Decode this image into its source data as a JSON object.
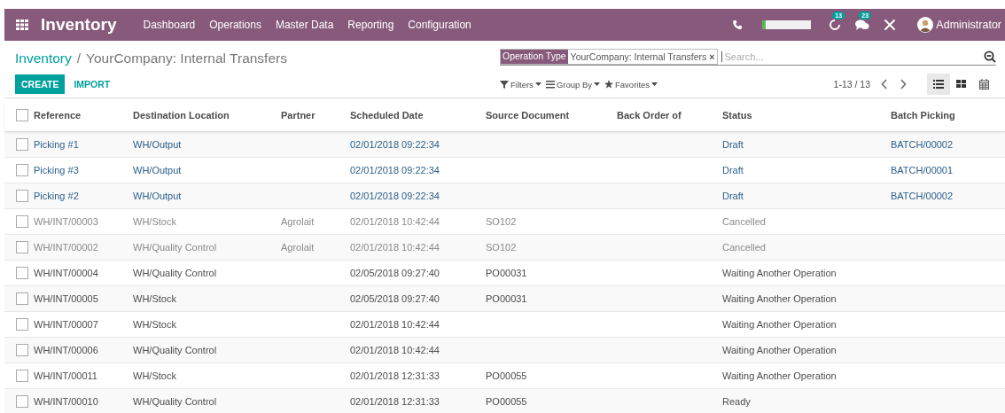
{
  "navbar": {
    "app_title": "Inventory",
    "menu": [
      "Dashboard",
      "Operations",
      "Master Data",
      "Reporting",
      "Configuration"
    ],
    "progress": {
      "level": 0.06
    },
    "activity_badge": "13",
    "messages_badge": "23",
    "user": "Administrator"
  },
  "breadcrumb": {
    "parent": "Inventory",
    "separator": "/",
    "current": "YourCompany: Internal Transfers"
  },
  "buttons": [
    "CREATE",
    "IMPORT"
  ],
  "search": {
    "facet": {
      "label": "Operation Type",
      "value": "YourCompany: Internal Transfers",
      "remove": "×"
    },
    "placeholder": "Search..."
  },
  "filters": [
    "Filters",
    "Group By",
    "Favorites"
  ],
  "pager": "1-13 / 13",
  "views": [
    {
      "kind": "list",
      "selected": true
    },
    {
      "kind": "kanban",
      "selected": false
    },
    {
      "kind": "calendar",
      "selected": false
    }
  ],
  "table": {
    "select_all": {
      "checked": false
    },
    "columns": [
      "Reference",
      "Destination Location",
      "Partner",
      "Scheduled Date",
      "Source Document",
      "Back Order of",
      "Status",
      "Batch Picking"
    ],
    "rows": [
      {
        "checked": false,
        "kind": "draft",
        "cells": [
          "Picking #1",
          "WH/Output",
          "",
          "02/01/2018 09:22:34",
          "",
          "",
          "Draft",
          "BATCH/00002"
        ]
      },
      {
        "checked": false,
        "kind": "draft",
        "cells": [
          "Picking #3",
          "WH/Output",
          "",
          "02/01/2018 09:22:34",
          "",
          "",
          "Draft",
          "BATCH/00001"
        ]
      },
      {
        "checked": false,
        "kind": "draft",
        "cells": [
          "Picking #2",
          "WH/Output",
          "",
          "02/01/2018 09:22:34",
          "",
          "",
          "Draft",
          "BATCH/00002"
        ]
      },
      {
        "checked": false,
        "kind": "cancelled",
        "cells": [
          "WH/INT/00003",
          "WH/Stock",
          "Agrolait",
          "02/01/2018 10:42:44",
          "SO102",
          "",
          "Cancelled",
          ""
        ]
      },
      {
        "checked": false,
        "kind": "cancelled",
        "cells": [
          "WH/INT/00002",
          "WH/Quality Control",
          "Agrolait",
          "02/01/2018 10:42:44",
          "SO102",
          "",
          "Cancelled",
          ""
        ]
      },
      {
        "checked": false,
        "kind": "normal",
        "cells": [
          "WH/INT/00004",
          "WH/Quality Control",
          "",
          "02/05/2018 09:27:40",
          "PO00031",
          "",
          "Waiting Another Operation",
          ""
        ]
      },
      {
        "checked": false,
        "kind": "normal",
        "cells": [
          "WH/INT/00005",
          "WH/Stock",
          "",
          "02/05/2018 09:27:40",
          "PO00031",
          "",
          "Waiting Another Operation",
          ""
        ]
      },
      {
        "checked": false,
        "kind": "normal",
        "cells": [
          "WH/INT/00007",
          "WH/Stock",
          "",
          "02/01/2018 10:42:44",
          "",
          "",
          "Waiting Another Operation",
          ""
        ]
      },
      {
        "checked": false,
        "kind": "normal",
        "cells": [
          "WH/INT/00006",
          "WH/Quality Control",
          "",
          "02/01/2018 10:42:44",
          "",
          "",
          "Waiting Another Operation",
          ""
        ]
      },
      {
        "checked": false,
        "kind": "normal",
        "cells": [
          "WH/INT/00011",
          "WH/Stock",
          "",
          "02/01/2018 12:31:33",
          "PO00055",
          "",
          "Waiting Another Operation",
          ""
        ]
      },
      {
        "checked": false,
        "kind": "normal",
        "cells": [
          "WH/INT/00010",
          "WH/Quality Control",
          "",
          "02/01/2018 12:31:33",
          "PO00055",
          "",
          "Ready",
          ""
        ]
      }
    ]
  }
}
